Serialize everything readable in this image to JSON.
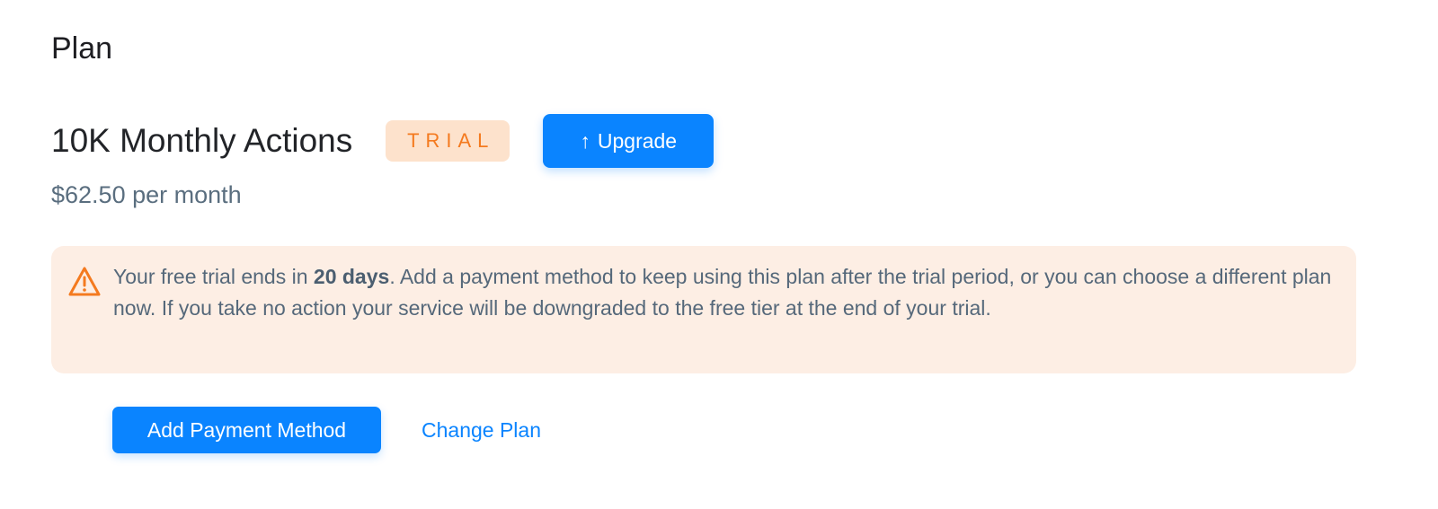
{
  "section": {
    "title": "Plan"
  },
  "plan": {
    "name": "10K Monthly Actions",
    "badge": "TRIAL",
    "price": "$62.50 per month",
    "upgrade": {
      "arrow": "↑",
      "label": "Upgrade"
    }
  },
  "alert": {
    "icon": "warning-triangle-icon",
    "text_before": "Your free trial ends in ",
    "days": "20 days",
    "text_after": ". Add a payment method to keep using this plan after the trial period, or you can choose a different plan now. If you take no action your service will be downgraded to the free tier at the end of your trial."
  },
  "actions": {
    "add_payment_label": "Add Payment Method",
    "change_plan_label": "Change Plan"
  },
  "colors": {
    "primary": "#0a84ff",
    "badge_bg": "#fde2cc",
    "badge_text": "#f47a1f",
    "alert_bg": "#fdeee4",
    "alert_icon": "#f47a1f"
  }
}
